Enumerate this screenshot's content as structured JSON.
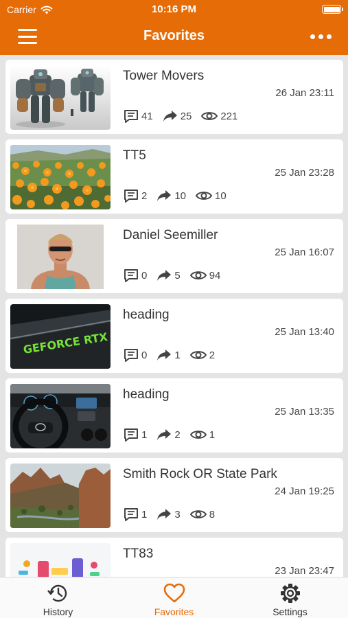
{
  "status_bar": {
    "carrier": "Carrier",
    "time": "10:16 PM"
  },
  "header": {
    "title": "Favorites",
    "menu_icon": "hamburger-menu-icon",
    "more_icon": "more-dots-icon"
  },
  "colors": {
    "accent": "#e56c07",
    "background": "#e4e4e4",
    "card": "#ffffff"
  },
  "items": [
    {
      "title": "Tower Movers",
      "date": "26 Jan 23:11",
      "comments": "41",
      "shares": "25",
      "views": "221",
      "thumbnail": "robot-figures"
    },
    {
      "title": "TT5",
      "date": "25 Jan 23:28",
      "comments": "2",
      "shares": "10",
      "views": "10",
      "thumbnail": "orange-poppies"
    },
    {
      "title": "Daniel Seemiller",
      "date": "25 Jan 16:07",
      "comments": "0",
      "shares": "5",
      "views": "94",
      "thumbnail": "man-sunglasses"
    },
    {
      "title": "heading",
      "date": "25 Jan 13:40",
      "comments": "0",
      "shares": "1",
      "views": "2",
      "thumbnail": "geforce-rtx-card"
    },
    {
      "title": "heading",
      "date": "25 Jan 13:35",
      "comments": "1",
      "shares": "2",
      "views": "1",
      "thumbnail": "car-dashboard"
    },
    {
      "title": "Smith Rock OR State Park",
      "date": "24 Jan 19:25",
      "comments": "1",
      "shares": "3",
      "views": "8",
      "thumbnail": "rock-canyon"
    },
    {
      "title": "TT83",
      "date": "23 Jan 23:47",
      "comments": "",
      "shares": "",
      "views": "",
      "thumbnail": "app-illustration"
    }
  ],
  "thumb_text": {
    "rtx": "GEFORCE RTX"
  },
  "tabs": [
    {
      "label": "History",
      "icon": "history-clock-icon"
    },
    {
      "label": "Favorites",
      "icon": "heart-icon",
      "active": true
    },
    {
      "label": "Settings",
      "icon": "gear-icon"
    }
  ]
}
